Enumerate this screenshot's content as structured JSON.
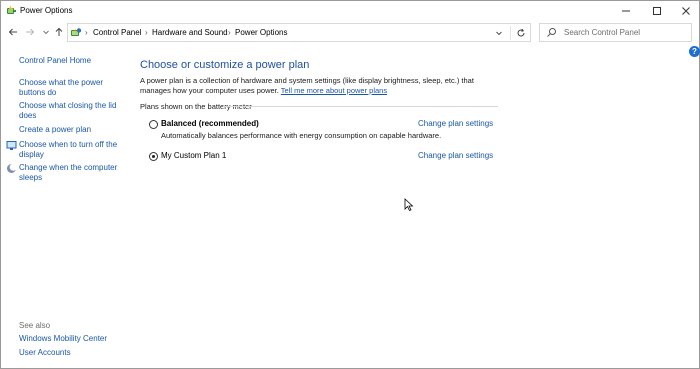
{
  "window": {
    "title": "Power Options"
  },
  "nav": {
    "breadcrumbs": [
      "Control Panel",
      "Hardware and Sound",
      "Power Options"
    ],
    "search_placeholder": "Search Control Panel"
  },
  "left_pane": {
    "home": "Control Panel Home",
    "links": [
      "Choose what the power buttons do",
      "Choose what closing the lid does",
      "Create a power plan",
      "Choose when to turn off the display",
      "Change when the computer sleeps"
    ],
    "see_also_heading": "See also",
    "see_also_links": [
      "Windows Mobility Center",
      "User Accounts"
    ]
  },
  "main": {
    "title": "Choose or customize a power plan",
    "intro_text": "A power plan is a collection of hardware and system settings (like display brightness, sleep, etc.) that manages how your computer uses power.",
    "intro_link": "Tell me more about power plans",
    "section_label": "Plans shown on the battery meter",
    "plans": [
      {
        "name": "Balanced (recommended)",
        "description": "Automatically balances performance with energy consumption on capable hardware.",
        "selected": false,
        "link": "Change plan settings"
      },
      {
        "name": "My Custom Plan 1",
        "description": "",
        "selected": true,
        "link": "Change plan settings"
      }
    ]
  },
  "colors": {
    "link": "#1a57a8",
    "title": "#1e4f9c",
    "help": "#1e6fcf"
  },
  "icons": [
    "power-options-icon",
    "minimize-icon",
    "maximize-icon",
    "close-icon",
    "back-arrow-icon",
    "forward-arrow-icon",
    "chevron-down-icon",
    "up-arrow-icon",
    "control-panel-icon",
    "refresh-icon",
    "search-icon",
    "help-icon",
    "display-icon",
    "moon-sleep-icon",
    "mouse-cursor-icon"
  ]
}
